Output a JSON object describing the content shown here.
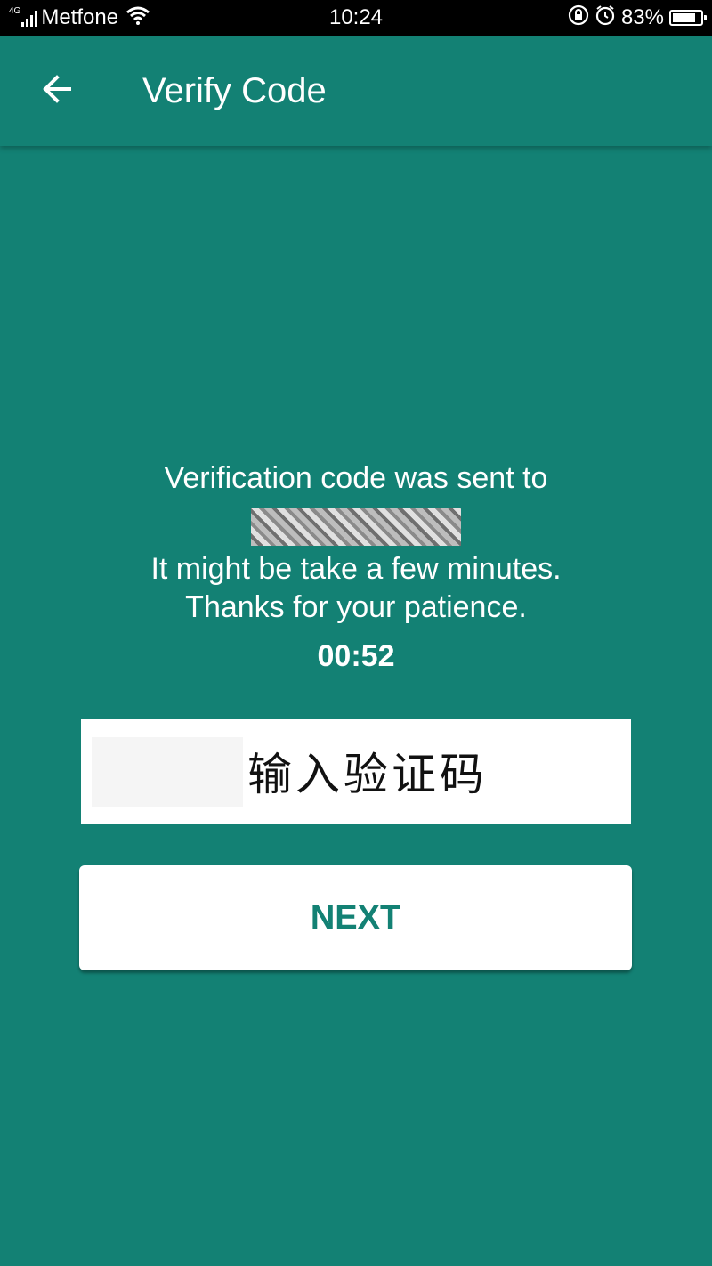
{
  "status_bar": {
    "network_type": "4G",
    "carrier": "Metfone",
    "time": "10:24",
    "battery": "83%",
    "battery_level": 0.83
  },
  "toolbar": {
    "title": "Verify Code"
  },
  "message": {
    "line1": "Verification code was sent to",
    "line2": "It might be take a few minutes.",
    "line3": "Thanks for your patience."
  },
  "timer": "00:52",
  "code_input": {
    "text": "输入验证码"
  },
  "next_button": {
    "label": "NEXT"
  },
  "colors": {
    "primary": "#138174",
    "status_bar": "#000000",
    "surface": "#ffffff"
  }
}
